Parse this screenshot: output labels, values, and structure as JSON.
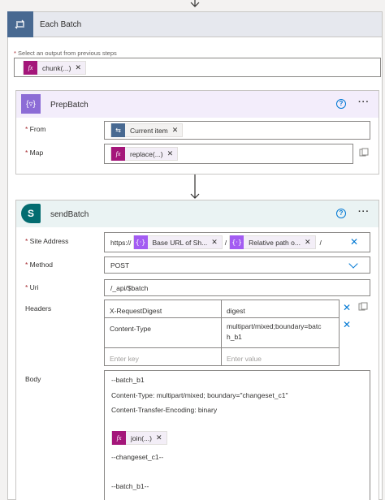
{
  "each": {
    "title": "Each Batch",
    "select_label": "Select an output from previous steps",
    "token": {
      "label": "chunk(...)",
      "icon": "fx"
    }
  },
  "prep": {
    "title": "PrepBatch",
    "help": "?",
    "more": "···",
    "from_label": "From",
    "from_token": "Current item",
    "map_label": "Map",
    "map_token": "replace(...)"
  },
  "send": {
    "title": "sendBatch",
    "help": "?",
    "more": "···",
    "site_label": "Site Address",
    "site_prefix": "https://",
    "site_token1": "Base URL of Sh...",
    "site_sep": "/",
    "site_token2": "Relative path o...",
    "site_suffix": "/",
    "method_label": "Method",
    "method_value": "POST",
    "uri_label": "Uri",
    "uri_value": "/_api/$batch",
    "headers_label": "Headers",
    "headers": [
      {
        "key": "X-RequestDigest",
        "value": "digest"
      },
      {
        "key": "Content-Type",
        "value_line1": "multipart/mixed;boundary=batc",
        "value_line2": "h_b1"
      }
    ],
    "key_placeholder": "Enter key",
    "value_placeholder": "Enter value",
    "body_label": "Body",
    "body_lines": [
      "--batch_b1",
      "Content-Type: multipart/mixed; boundary=\"changeset_c1\"",
      "Content-Transfer-Encoding: binary"
    ],
    "body_token": "join(...)",
    "body_after": "--changeset_c1--",
    "body_end": "--batch_b1--"
  },
  "colors": {
    "accent_blue": "#0078d4",
    "loop_icon": "#486991",
    "prep_accent": "#8c6cd6",
    "sharepoint_green": "#036c70",
    "fx_magenta": "#a4167a",
    "dynamic_lavender": "#a35cf2"
  }
}
